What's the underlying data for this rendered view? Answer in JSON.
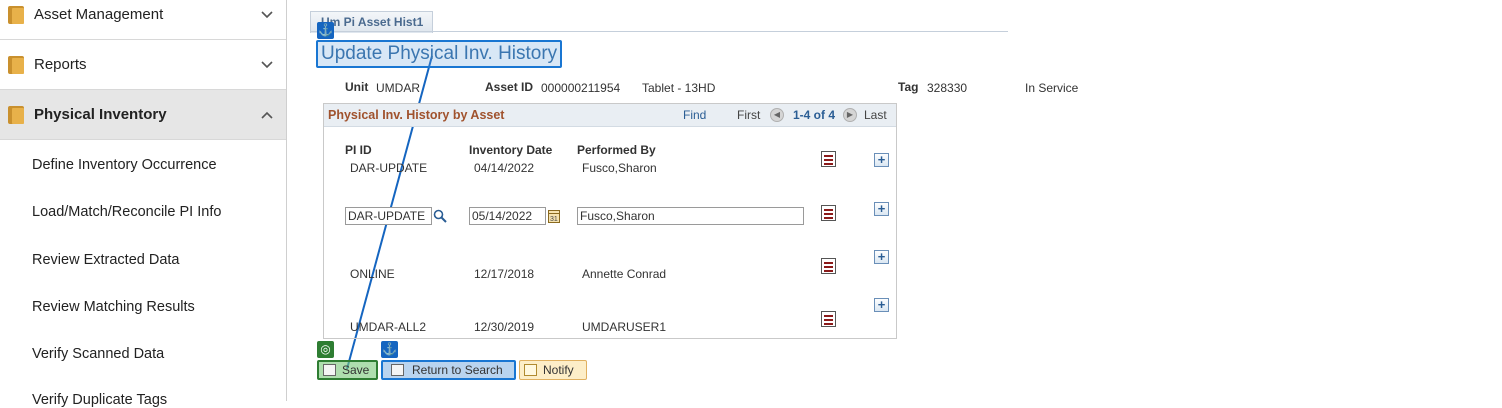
{
  "sidebar": {
    "categories": [
      {
        "label": "Asset Management"
      },
      {
        "label": "Reports"
      },
      {
        "label": "Physical Inventory"
      }
    ],
    "items": [
      {
        "label": "Define Inventory Occurrence"
      },
      {
        "label": "Load/Match/Reconcile PI Info"
      },
      {
        "label": "Review Extracted Data"
      },
      {
        "label": "Review Matching Results"
      },
      {
        "label": "Verify Scanned Data"
      },
      {
        "label": "Verify Duplicate Tags"
      }
    ]
  },
  "tab": {
    "label": "Um Pi Asset Hist1"
  },
  "page": {
    "title": "Update Physical Inv. History"
  },
  "header": {
    "unit_label": "Unit",
    "unit_value": "UMDAR",
    "asset_id_label": "Asset ID",
    "asset_id_value": "000000211954",
    "asset_desc": "Tablet - 13HD",
    "tag_label": "Tag",
    "tag_value": "328330",
    "status": "In Service"
  },
  "grid": {
    "title": "Physical Inv. History by Asset",
    "find": "Find",
    "first": "First",
    "range": "1-4 of 4",
    "last": "Last",
    "columns": [
      "PI ID",
      "Inventory Date",
      "Performed By"
    ],
    "rows": [
      {
        "pi_id": "DAR-UPDATE",
        "date": "04/14/2022",
        "by": "Fusco,Sharon"
      },
      {
        "pi_id": "DAR-UPDATE",
        "date": "05/14/2022",
        "by": "Fusco,Sharon"
      },
      {
        "pi_id": "ONLINE",
        "date": "12/17/2018",
        "by": "Annette Conrad"
      },
      {
        "pi_id": "UMDAR-ALL2",
        "date": "12/30/2019",
        "by": "UMDARUSER1"
      }
    ]
  },
  "buttons": {
    "save": "Save",
    "return": "Return to Search",
    "notify": "Notify"
  },
  "icons": {
    "anchor": "⚓",
    "target": "◎"
  }
}
